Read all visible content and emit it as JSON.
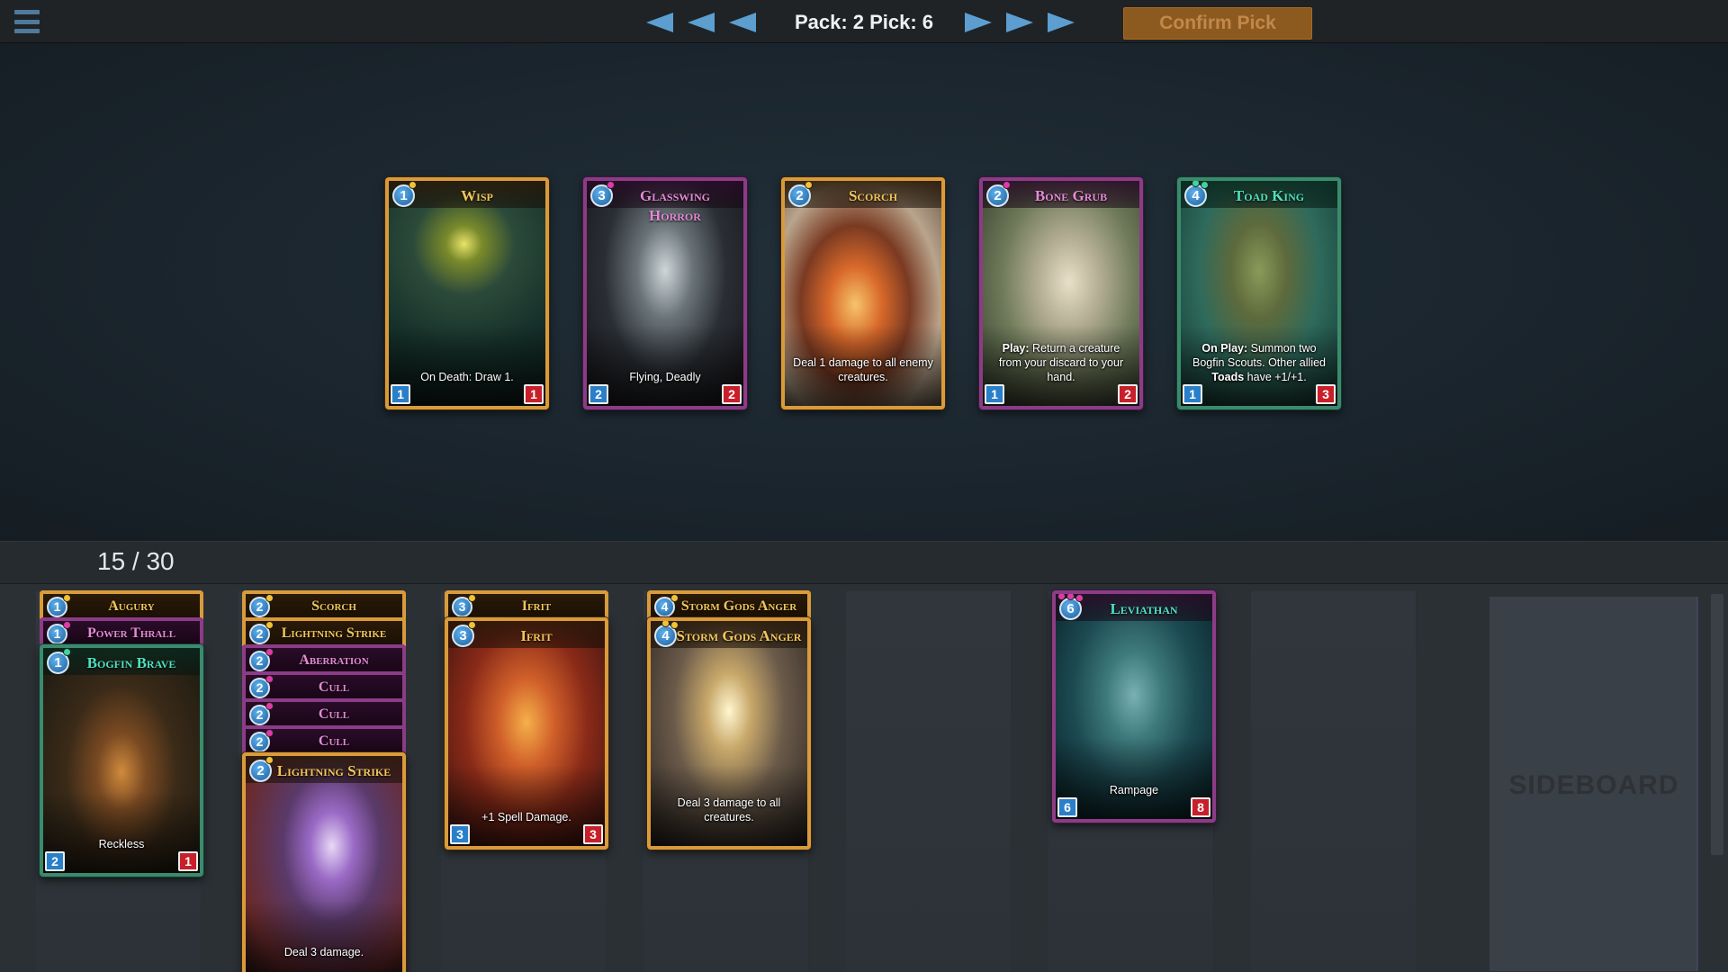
{
  "header": {
    "pack_pick": "Pack: 2 Pick: 6",
    "confirm_label": "Confirm Pick"
  },
  "deck": {
    "count": "15 / 30",
    "sideboard_label": "SIDEBOARD"
  },
  "pack_cards": [
    {
      "name": "Wisp",
      "cost": "1",
      "attack": "1",
      "health": "1",
      "text": "On Death: Draw 1.",
      "frame": "gold",
      "name_color": "gold"
    },
    {
      "name": "Glasswing Horror",
      "cost": "3",
      "attack": "2",
      "health": "2",
      "text": "Flying, Deadly",
      "frame": "purple",
      "name_color": "pink"
    },
    {
      "name": "Scorch",
      "cost": "2",
      "text": "Deal 1 damage to all enemy creatures.",
      "frame": "gold",
      "name_color": "gold"
    },
    {
      "name": "Bone Grub",
      "cost": "2",
      "attack": "1",
      "health": "2",
      "text_bold": "Play:",
      "text": "Return a creature from your discard to your hand.",
      "frame": "purple",
      "name_color": "pink"
    },
    {
      "name": "Toad King",
      "cost": "4",
      "attack": "1",
      "health": "3",
      "text_bold": "On Play:",
      "text": "Summon two Bogfin Scouts. Other allied",
      "text_bold2": "Toads",
      "text2": "have +1/+1.",
      "frame": "green",
      "name_color": "teal"
    }
  ],
  "deck_columns": [
    {
      "strips": [
        {
          "name": "Augury",
          "cost": "1",
          "frame": "gold",
          "name_color": "gold"
        },
        {
          "name": "Power Thrall",
          "cost": "1",
          "frame": "purple",
          "name_color": "pink"
        }
      ],
      "card": {
        "name": "Bogfin Brave",
        "cost": "1",
        "attack": "2",
        "health": "1",
        "text": "Reckless",
        "frame": "green",
        "name_color": "teal"
      }
    },
    {
      "strips": [
        {
          "name": "Scorch",
          "cost": "2",
          "frame": "gold",
          "name_color": "gold"
        },
        {
          "name": "Lightning Strike",
          "cost": "2",
          "frame": "gold",
          "name_color": "gold"
        },
        {
          "name": "Aberration",
          "cost": "2",
          "frame": "purple",
          "name_color": "pink"
        },
        {
          "name": "Cull",
          "cost": "2",
          "frame": "purple",
          "name_color": "pink"
        },
        {
          "name": "Cull",
          "cost": "2",
          "frame": "purple",
          "name_color": "pink"
        },
        {
          "name": "Cull",
          "cost": "2",
          "frame": "purple",
          "name_color": "pink"
        }
      ],
      "card": {
        "name": "Lightning Strike",
        "cost": "2",
        "text": "Deal 3 damage.",
        "frame": "gold",
        "name_color": "gold"
      }
    },
    {
      "strips": [
        {
          "name": "Ifrit",
          "cost": "3",
          "frame": "gold",
          "name_color": "gold"
        }
      ],
      "card": {
        "name": "Ifrit",
        "cost": "3",
        "attack": "3",
        "health": "3",
        "text": "+1 Spell Damage.",
        "frame": "gold",
        "name_color": "gold"
      }
    },
    {
      "strips": [
        {
          "name": "Storm Gods Anger",
          "cost": "4",
          "frame": "gold",
          "name_color": "gold"
        }
      ],
      "card": {
        "name": "Storm Gods Anger",
        "cost": "4",
        "text": "Deal 3 damage to all creatures.",
        "frame": "gold",
        "name_color": "gold"
      }
    },
    {
      "strips": [],
      "card": null
    },
    {
      "strips": [],
      "card": {
        "name": "Leviathan",
        "cost": "6",
        "attack": "6",
        "health": "8",
        "text": "Rampage",
        "frame": "purple",
        "name_color": "teal"
      }
    },
    {
      "strips": [],
      "card": null
    },
    {
      "strips": [],
      "card": null
    }
  ],
  "colors": {
    "gold_frame": "#d99b3a",
    "purple_frame": "#8c3c86",
    "green_frame": "#3c8a6e",
    "attack_blue": "#2a7fc9",
    "health_red": "#c8202a",
    "confirm_bg": "#8c5a1e",
    "arrow_blue": "#5c9ed0"
  },
  "icons": {
    "menu": "hamburger-menu-icon",
    "prev": "triangle-left-icon",
    "next": "triangle-right-icon"
  }
}
